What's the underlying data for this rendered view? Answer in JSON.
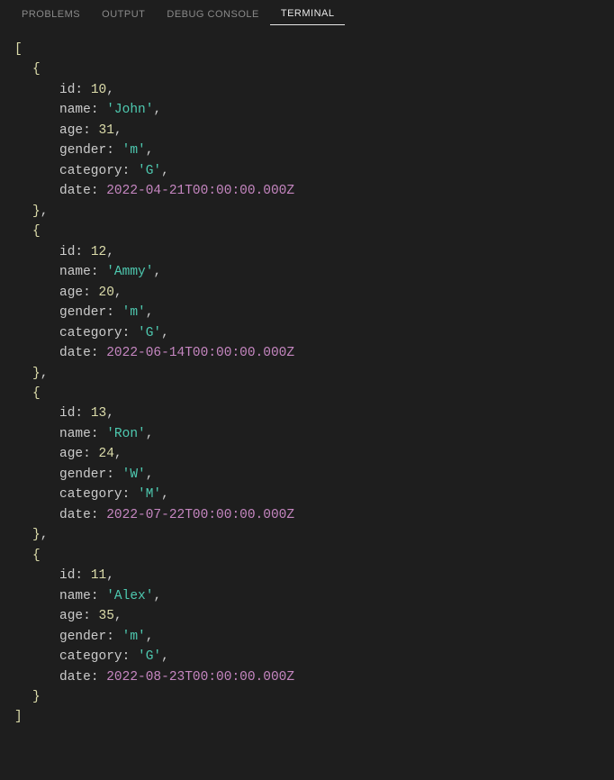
{
  "tabs": {
    "problems": "PROBLEMS",
    "output": "OUTPUT",
    "debug_console": "DEBUG CONSOLE",
    "terminal": "TERMINAL"
  },
  "records": [
    {
      "id": "10",
      "name": "'John'",
      "age": "31",
      "gender": "'m'",
      "category": "'G'",
      "date": "2022-04-21T00:00:00.000Z"
    },
    {
      "id": "12",
      "name": "'Ammy'",
      "age": "20",
      "gender": "'m'",
      "category": "'G'",
      "date": "2022-06-14T00:00:00.000Z"
    },
    {
      "id": "13",
      "name": "'Ron'",
      "age": "24",
      "gender": "'W'",
      "category": "'M'",
      "date": "2022-07-22T00:00:00.000Z"
    },
    {
      "id": "11",
      "name": "'Alex'",
      "age": "35",
      "gender": "'m'",
      "category": "'G'",
      "date": "2022-08-23T00:00:00.000Z"
    }
  ],
  "keys": {
    "id": "id",
    "name": "name",
    "age": "age",
    "gender": "gender",
    "category": "category",
    "date": "date"
  }
}
